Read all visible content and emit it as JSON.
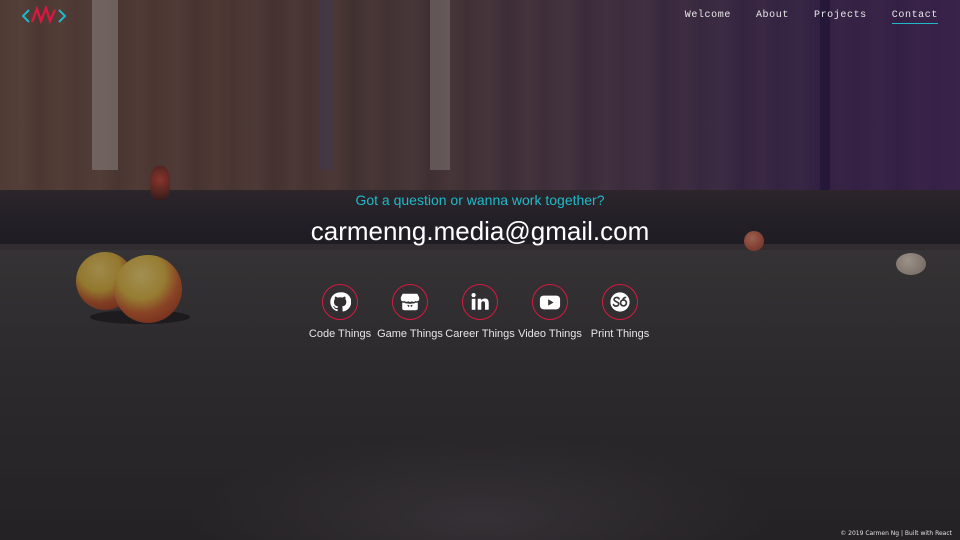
{
  "header": {
    "logo_icon": "nn-zigzag-logo-icon",
    "colors": {
      "logo_teal": "#1fb9c9",
      "logo_red": "#d8193f"
    },
    "nav": [
      {
        "label": "Welcome"
      },
      {
        "label": "About"
      },
      {
        "label": "Projects"
      },
      {
        "label": "Contact",
        "active": true
      }
    ]
  },
  "contact": {
    "tagline": "Got a question or wanna work together?",
    "email": "carmenng.media@gmail.com",
    "socials": [
      {
        "icon": "github-icon",
        "label": "Code Things"
      },
      {
        "icon": "itch-io-icon",
        "label": "Game Things"
      },
      {
        "icon": "linkedin-icon",
        "label": "Career Things"
      },
      {
        "icon": "youtube-icon",
        "label": "Video Things"
      },
      {
        "icon": "shapeways-icon",
        "label": "Print Things"
      }
    ]
  },
  "footer": {
    "text": "© 2019 Carmen Ng | Built with React"
  },
  "colors": {
    "accent": "#1fb9c9",
    "ring": "#d8193f",
    "text": "#ffffff"
  }
}
